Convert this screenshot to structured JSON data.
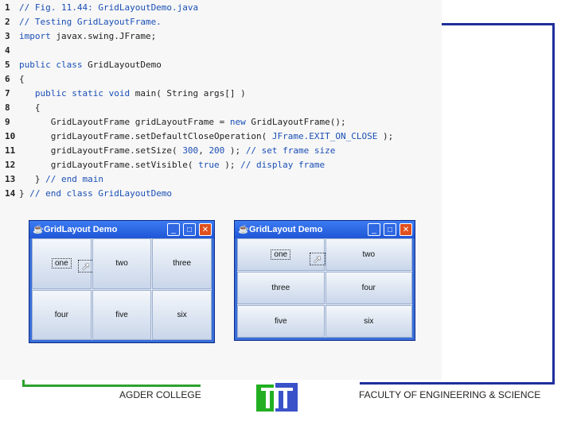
{
  "code_lines": [
    {
      "n": "1",
      "parts": [
        {
          "t": "// Fig. 11.44: GridLayoutDemo.java",
          "k": "c"
        }
      ]
    },
    {
      "n": "2",
      "parts": [
        {
          "t": "// Testing GridLayoutFrame.",
          "k": "c"
        }
      ]
    },
    {
      "n": "3",
      "parts": [
        {
          "t": "import",
          "k": "kw"
        },
        {
          "t": " javax.swing.JFrame;",
          "k": "tx"
        }
      ]
    },
    {
      "n": "4",
      "parts": []
    },
    {
      "n": "5",
      "parts": [
        {
          "t": "public class",
          "k": "kw"
        },
        {
          "t": " GridLayoutDemo",
          "k": "tx"
        }
      ]
    },
    {
      "n": "6",
      "parts": [
        {
          "t": "{",
          "k": "tx"
        }
      ]
    },
    {
      "n": "7",
      "parts": [
        {
          "t": "   public static void",
          "k": "kw"
        },
        {
          "t": " main( String args[] )",
          "k": "tx"
        }
      ]
    },
    {
      "n": "8",
      "parts": [
        {
          "t": "   {",
          "k": "tx"
        }
      ]
    },
    {
      "n": "9",
      "parts": [
        {
          "t": "      GridLayoutFrame gridLayoutFrame = ",
          "k": "tx"
        },
        {
          "t": "new",
          "k": "kw"
        },
        {
          "t": " GridLayoutFrame();",
          "k": "tx"
        }
      ]
    },
    {
      "n": "10",
      "parts": [
        {
          "t": "      gridLayoutFrame.setDefaultCloseOperation( ",
          "k": "tx"
        },
        {
          "t": "JFrame.EXIT_ON_CLOSE",
          "k": "const"
        },
        {
          "t": " );",
          "k": "tx"
        }
      ]
    },
    {
      "n": "11",
      "parts": [
        {
          "t": "      gridLayoutFrame.setSize( ",
          "k": "tx"
        },
        {
          "t": "300",
          "k": "lit"
        },
        {
          "t": ", ",
          "k": "tx"
        },
        {
          "t": "200",
          "k": "lit"
        },
        {
          "t": " ); ",
          "k": "tx"
        },
        {
          "t": "// set frame size",
          "k": "c"
        }
      ]
    },
    {
      "n": "12",
      "parts": [
        {
          "t": "      gridLayoutFrame.setVisible( ",
          "k": "tx"
        },
        {
          "t": "true",
          "k": "kw"
        },
        {
          "t": " ); ",
          "k": "tx"
        },
        {
          "t": "// display frame",
          "k": "c"
        }
      ]
    },
    {
      "n": "13",
      "parts": [
        {
          "t": "   } ",
          "k": "tx"
        },
        {
          "t": "// end main",
          "k": "c"
        }
      ]
    },
    {
      "n": "14",
      "parts": [
        {
          "t": "} ",
          "k": "tx"
        },
        {
          "t": "// end class GridLayoutDemo",
          "k": "c"
        }
      ]
    }
  ],
  "window1": {
    "title": "GridLayout Demo",
    "buttons": [
      "one",
      "two",
      "three",
      "four",
      "five",
      "six"
    ]
  },
  "window2": {
    "title": "GridLayout Demo",
    "buttons": [
      "one",
      "two",
      "three",
      "four",
      "five",
      "six"
    ]
  },
  "footer": {
    "left": "AGDER COLLEGE",
    "right": "FACULTY OF ENGINEERING & SCIENCE"
  },
  "icons": {
    "java": "java-cup-icon",
    "minimize": "minimize-icon",
    "maximize": "maximize-icon",
    "close": "close-icon",
    "cursor": "mouse-cursor-icon",
    "logo": "college-logo-icon"
  },
  "colors": {
    "code_comment": "#1a4fb5",
    "titlebar": "#1f56d6",
    "frame_blue": "#1f2f9a",
    "frame_green": "#2ea22e"
  }
}
